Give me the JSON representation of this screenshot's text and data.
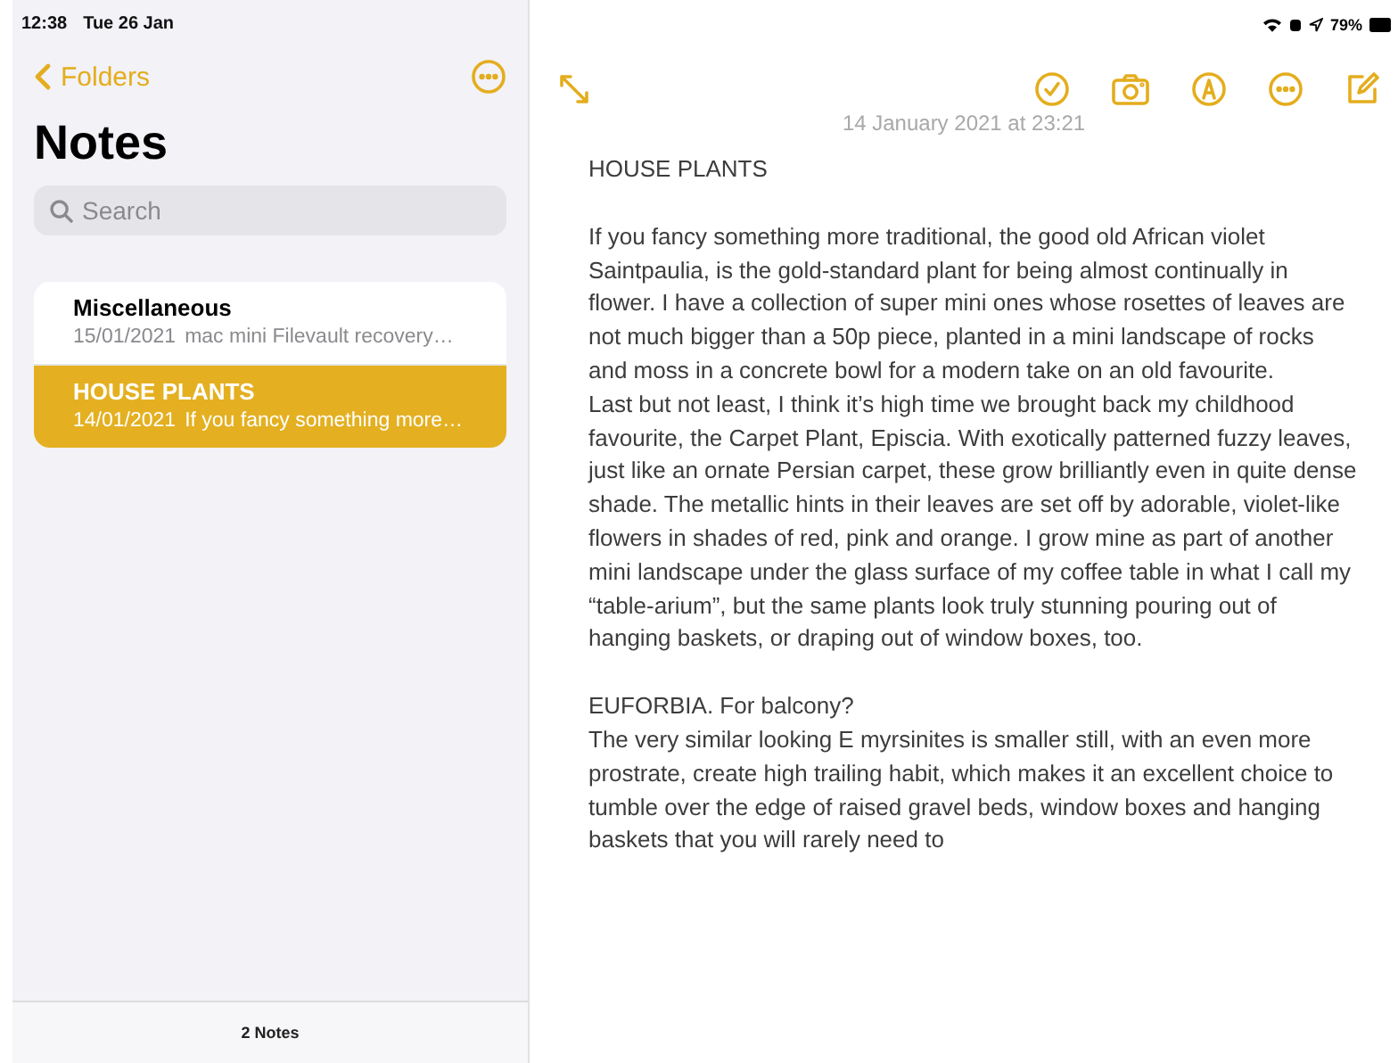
{
  "status_bar": {
    "time": "12:38",
    "date": "Tue 26 Jan",
    "battery": "79%"
  },
  "sidebar": {
    "back_label": "Folders",
    "title": "Notes",
    "search": {
      "placeholder": "Search"
    },
    "notes": [
      {
        "title": "Miscellaneous",
        "date": "15/01/2021",
        "preview": "mac mini Filevault recovery…",
        "selected": false
      },
      {
        "title": "HOUSE PLANTS",
        "date": "14/01/2021",
        "preview": "If you fancy something more…",
        "selected": true
      }
    ],
    "footer": "2 Notes"
  },
  "note": {
    "timestamp": "14 January 2021 at 23:21",
    "sections": [
      [
        "HOUSE PLANTS"
      ],
      [
        "If you fancy something more traditional, the good old African violet Saintpaulia, is the gold-standard plant for being almost continually in flower. I have a collection of super mini ones whose rosettes of leaves are not much bigger than a 50p piece, planted in a mini landscape of rocks and moss in a concrete bowl for a modern take on an old favourite.",
        "Last but not least, I think it’s high time we brought back my childhood favourite, the Carpet Plant, Episcia. With exotically patterned fuzzy leaves, just like an ornate Persian carpet, these grow brilliantly even in quite dense shade. The metallic hints in their leaves are set off by adorable, violet-like flowers in shades of red, pink and orange. I grow mine as part of another mini landscape under the glass surface of my coffee table in what I call my “table-arium”, but the same plants look truly stunning pouring out of hanging baskets, or draping out of window boxes, too."
      ],
      [
        "EUFORBIA. For balcony?",
        "The very similar looking E myrsinites is smaller still, with an even more prostrate, create high trailing habit, which makes it an excellent choice to tumble over the edge of raised gravel beds, window boxes and hanging baskets that you will rarely need to"
      ]
    ]
  }
}
